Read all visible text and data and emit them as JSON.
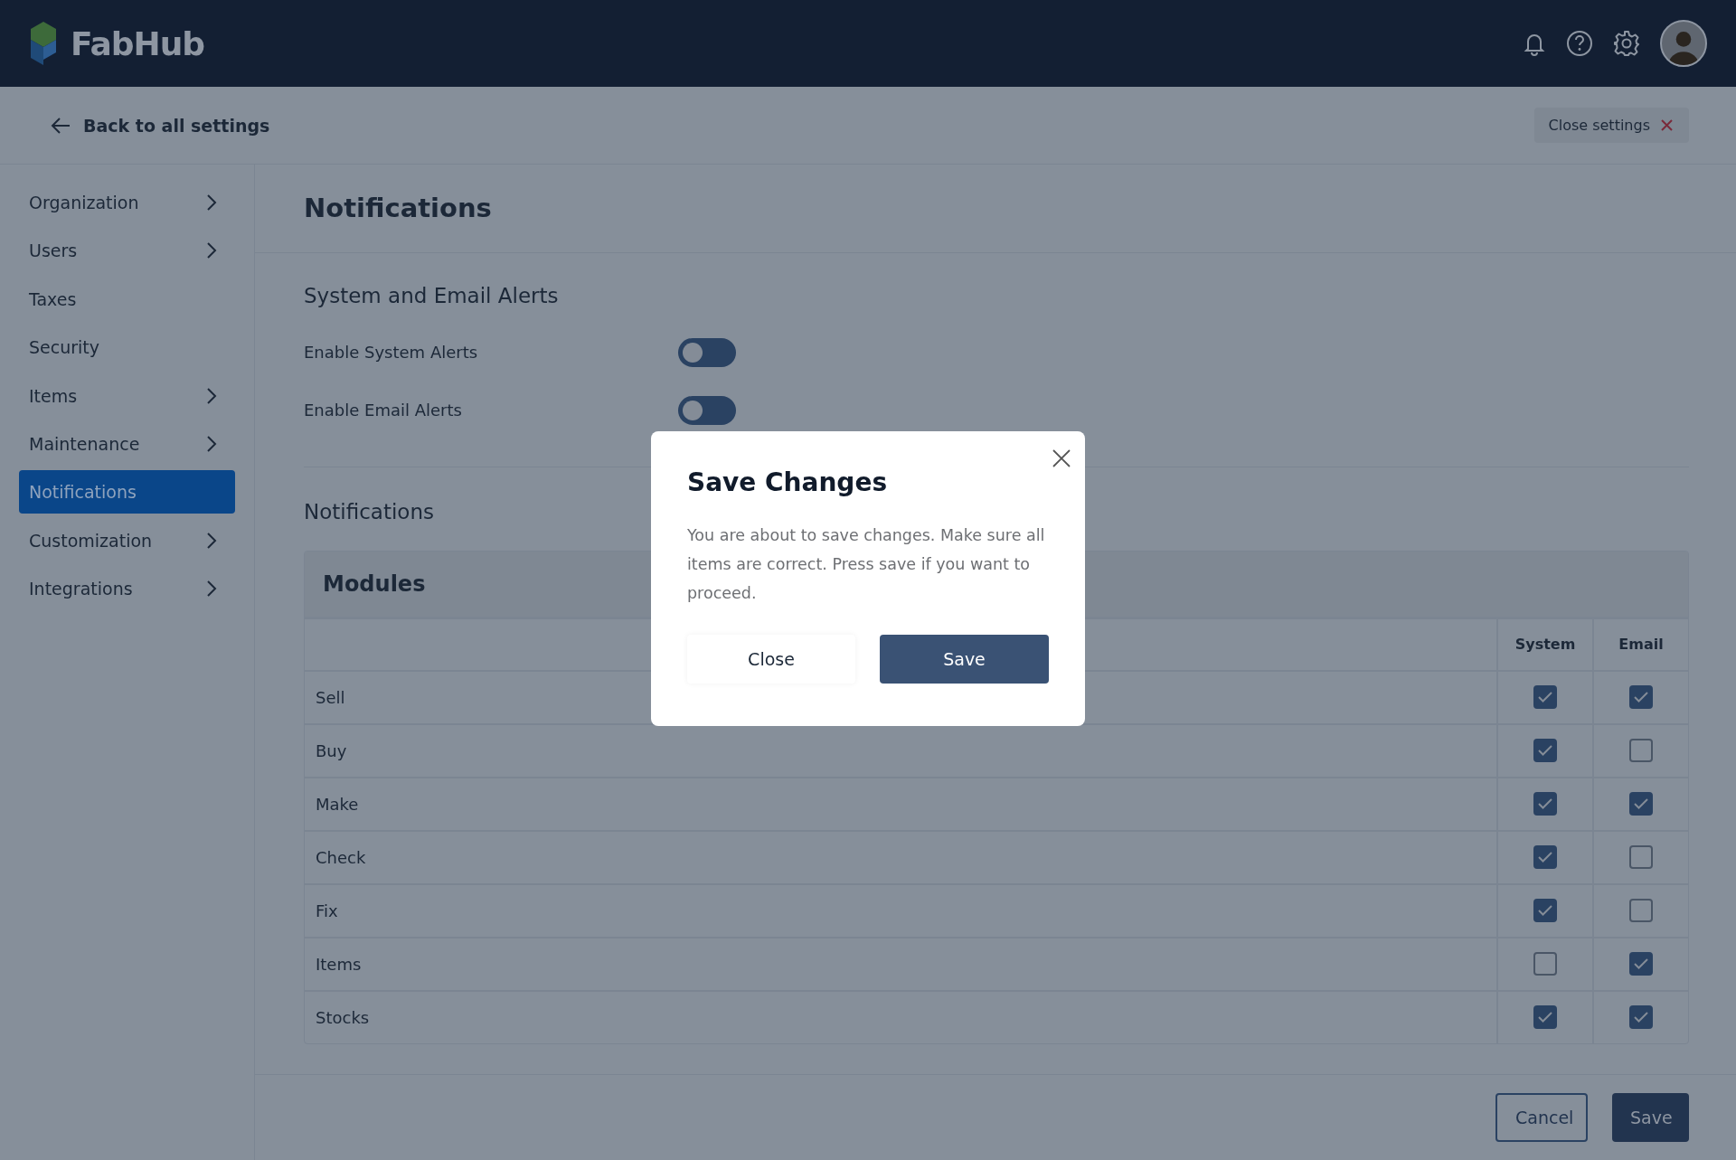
{
  "app": {
    "name": "FabHub"
  },
  "subheader": {
    "back_link": "Back to all settings",
    "close_button": "Close settings"
  },
  "sidebar": {
    "items": [
      {
        "label": "Organization",
        "expandable": true,
        "selected": false
      },
      {
        "label": "Users",
        "expandable": true,
        "selected": false
      },
      {
        "label": "Taxes",
        "expandable": false,
        "selected": false
      },
      {
        "label": "Security",
        "expandable": false,
        "selected": false
      },
      {
        "label": "Items",
        "expandable": true,
        "selected": false
      },
      {
        "label": "Maintenance",
        "expandable": true,
        "selected": false
      },
      {
        "label": "Notifications",
        "expandable": false,
        "selected": true
      },
      {
        "label": "Customization",
        "expandable": true,
        "selected": false
      },
      {
        "label": "Integrations",
        "expandable": true,
        "selected": false
      }
    ]
  },
  "page_title": "Notifications",
  "alerts": {
    "title": "System and Email Alerts",
    "toggles": [
      {
        "label": "Enable System Alerts",
        "on": false
      },
      {
        "label": "Enable Email Alerts",
        "on": false
      }
    ]
  },
  "notifications": {
    "title": "Notifications",
    "table_title": "Modules",
    "columns": [
      "System",
      "Email"
    ],
    "rows": [
      {
        "module": "Sell",
        "system": true,
        "email": true
      },
      {
        "module": "Buy",
        "system": true,
        "email": false
      },
      {
        "module": "Make",
        "system": true,
        "email": true
      },
      {
        "module": "Check",
        "system": true,
        "email": false
      },
      {
        "module": "Fix",
        "system": true,
        "email": false
      },
      {
        "module": "Items",
        "system": false,
        "email": true
      },
      {
        "module": "Stocks",
        "system": true,
        "email": true
      }
    ]
  },
  "footer": {
    "buttons": [
      "Cancel",
      "Save"
    ]
  },
  "dialog": {
    "title": "Save Changes",
    "message": "You are about to save changes. Make sure all items are correct. Press save if you want to proceed.",
    "buttons": [
      "Close",
      "Save"
    ]
  }
}
